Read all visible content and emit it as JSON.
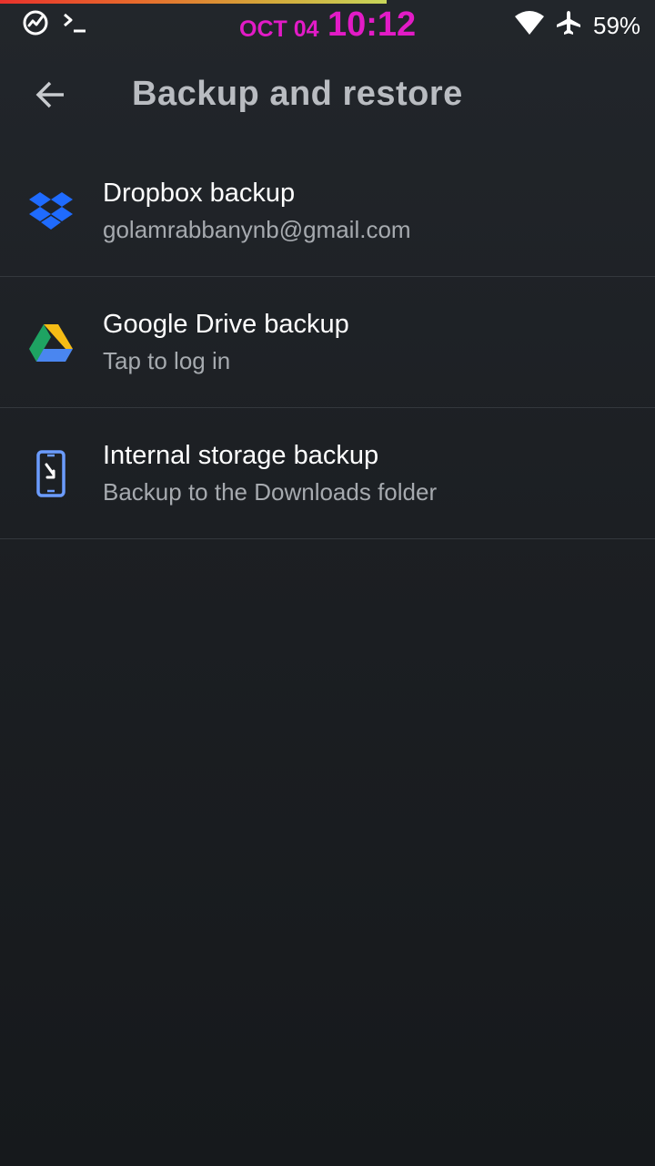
{
  "status_bar": {
    "date": "OCT 04",
    "time": "10:12",
    "battery": "59%",
    "accent_color": "#e21bc6",
    "icons": [
      "activity-icon",
      "terminal-icon",
      "wifi-icon",
      "airplane-mode-icon"
    ]
  },
  "app_bar": {
    "back_icon": "arrow-left-icon",
    "title": "Backup and restore"
  },
  "items": [
    {
      "icon": "dropbox-icon",
      "title": "Dropbox backup",
      "subtitle": "golamrabbanynb@gmail.com"
    },
    {
      "icon": "google-drive-icon",
      "title": "Google Drive backup",
      "subtitle": "Tap to log in"
    },
    {
      "icon": "phone-download-icon",
      "title": "Internal storage backup",
      "subtitle": "Backup to the Downloads folder"
    }
  ],
  "colors": {
    "background": "#1c1f23",
    "title_text": "#b9bcc1",
    "subtitle_text": "#a6aaaf",
    "divider": "#34383d"
  }
}
